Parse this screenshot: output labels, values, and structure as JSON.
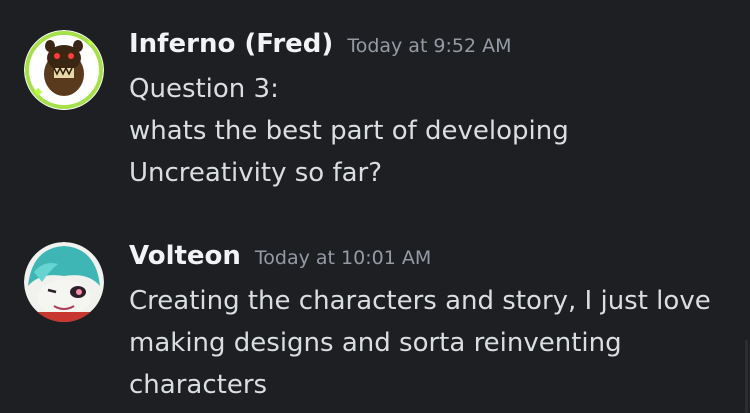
{
  "messages": [
    {
      "author": "Inferno (Fred)",
      "timestamp": "Today at 9:52 AM",
      "lines": [
        "Question 3:",
        "whats the best part of developing",
        "Uncreativity so far?"
      ]
    },
    {
      "author": "Volteon",
      "timestamp": "Today at 10:01 AM",
      "lines": [
        "Creating the characters and story, I just love",
        "making designs and sorta reinventing",
        "characters"
      ]
    }
  ],
  "colors": {
    "background": "#1e1f22",
    "username": "#f2f3f5",
    "timestamp": "#949ba4",
    "message_text": "#dbdee1"
  }
}
